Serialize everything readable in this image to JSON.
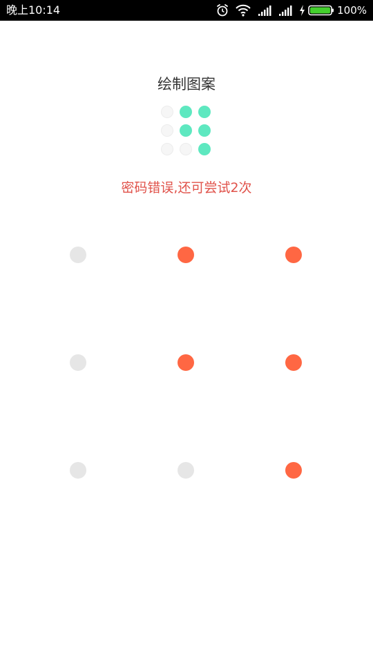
{
  "status_bar": {
    "time": "晚上10:14",
    "battery": "100%",
    "icons": [
      "alarm-icon",
      "wifi-icon",
      "signal-icon",
      "signal-icon",
      "charging-icon",
      "battery-icon"
    ]
  },
  "title": "绘制图案",
  "preview": {
    "rows": [
      [
        false,
        true,
        true
      ],
      [
        false,
        true,
        true
      ],
      [
        false,
        false,
        true
      ]
    ],
    "active_color": "#5ee8c0",
    "inactive_color": "#f6f6f6"
  },
  "error_message": "密码错误,还可尝试2次",
  "pattern": {
    "rows": [
      [
        false,
        true,
        true
      ],
      [
        false,
        true,
        true
      ],
      [
        false,
        false,
        true
      ]
    ],
    "active_color": "#ff6743",
    "inactive_color": "#e6e6e6"
  },
  "colors": {
    "error_text": "#e0524a",
    "status_bar_bg": "#000000",
    "battery_green": "#43d02d"
  }
}
